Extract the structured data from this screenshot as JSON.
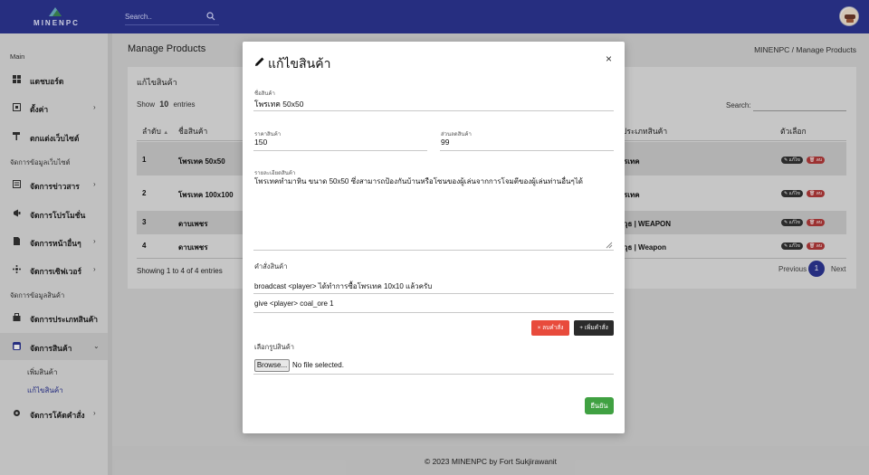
{
  "brand": {
    "name": "MINENPC"
  },
  "topbar": {
    "search_placeholder": "Search.."
  },
  "sidebar": {
    "section_main": "Main",
    "section_site": "จัดการข้อมูลเว็บไซต์",
    "section_products": "จัดการข้อมูลสินค้า",
    "items": [
      {
        "label": "แดชบอร์ด"
      },
      {
        "label": "ตั้งค่า",
        "chevron": "›"
      },
      {
        "label": "ตกแต่งเว็บไซต์"
      },
      {
        "label": "จัดการข่าวสาร",
        "chevron": "›"
      },
      {
        "label": "จัดการโปรโมชั่น"
      },
      {
        "label": "จัดการหน้าอื่นๆ",
        "chevron": "›"
      },
      {
        "label": "จัดการเซิฟเวอร์",
        "chevron": "›"
      },
      {
        "label": "จัดการประเภทสินค้า",
        "chevron": "›"
      },
      {
        "label": "จัดการสินค้า",
        "chevron": "⌄"
      },
      {
        "label": "จัดการโค้ดคำสั่ง",
        "chevron": "›"
      }
    ],
    "sub_items": [
      {
        "label": "เพิ่มสินค้า"
      },
      {
        "label": "แก้ไขสินค้า"
      }
    ]
  },
  "page": {
    "title": "Manage Products",
    "breadcrumb": "MINENPC  /  Manage Products"
  },
  "card": {
    "title": "แก้ไขสินค้า",
    "show_prefix": "Show",
    "show_value": "10",
    "show_suffix": "entries",
    "search_label": "Search:",
    "columns": [
      "ลำดับ",
      "ชื่อสินค้า",
      "ประเภทสินค้า",
      "ตัวเลือก"
    ],
    "rows": [
      {
        "no": "1",
        "name": "โพรเทค 50x50",
        "type": "รเทค"
      },
      {
        "no": "2",
        "name": "โพรเทค 100x100",
        "type": "รเทค"
      },
      {
        "no": "3",
        "name": "ดาบเพชร",
        "type": "วุธ | WEAPON"
      },
      {
        "no": "4",
        "name": "ดาบเพชร",
        "type": "วุธ | Weapon"
      }
    ],
    "edit_tag": "แก้ไข",
    "delete_tag": "ลบ",
    "showing": "Showing 1 to 4 of 4 entries",
    "prev": "Previous",
    "current_page": "1",
    "next": "Next"
  },
  "modal": {
    "title": "แก้ไขสินค้า",
    "close": "×",
    "name_label": "ชื่อสินค้า",
    "name_value": "โพรเทค 50x50",
    "price_label": "ราคาสินค้า",
    "price_value": "150",
    "discount_label": "ส่วนลดสินค้า",
    "discount_value": "99",
    "desc_label": "รายละเอียดสินค้า",
    "desc_value": "โพรเทคทำมาหิน ขนาด 50x50 ซึ่งสามารถป้องกันบ้านหรือโซนของผู้เล่นจากการโจมตีของผู้เล่นท่านอื่นๆได้",
    "commands_label": "คำสั่งสินค้า",
    "commands": [
      "broadcast <player> ได้ทำการซื้อโพรเทค 10x10 แล้วครับ",
      "give <player> coal_ore 1"
    ],
    "delete_command": "× ลบคำสั่ง",
    "add_command": "+ เพิ่มคำสั่ง",
    "image_label": "เลือกรูปสินค้า",
    "browse": "Browse...",
    "no_file": "No file selected.",
    "confirm": "ยืนยัน"
  },
  "footer": {
    "text": "© 2023 MINENPC by Fort Sukjirawanit"
  },
  "colors": {
    "primary": "#2c3592",
    "danger": "#e84b3c",
    "success": "#40a142"
  }
}
